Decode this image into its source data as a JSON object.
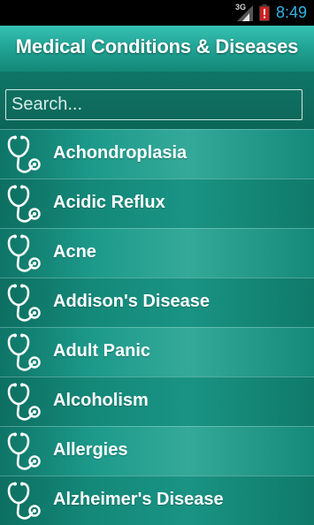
{
  "status_bar": {
    "network": "3G",
    "time": "8:49",
    "icons": [
      "signal-icon",
      "battery-icon"
    ]
  },
  "title_bar": {
    "title": "Medical Conditions & Diseases"
  },
  "search": {
    "placeholder": "Search...",
    "value": ""
  },
  "list": {
    "icon": "stethoscope-icon",
    "items": [
      {
        "label": "Achondroplasia"
      },
      {
        "label": "Acidic Reflux"
      },
      {
        "label": "Acne"
      },
      {
        "label": "Addison's Disease"
      },
      {
        "label": "Adult Panic"
      },
      {
        "label": "Alcoholism"
      },
      {
        "label": "Allergies"
      },
      {
        "label": "Alzheimer's Disease"
      }
    ]
  },
  "colors": {
    "title_bar": "#22a596",
    "list_background": "#0e6a5e",
    "clock": "#33b5e5",
    "battery_alert": "#cc2222"
  }
}
